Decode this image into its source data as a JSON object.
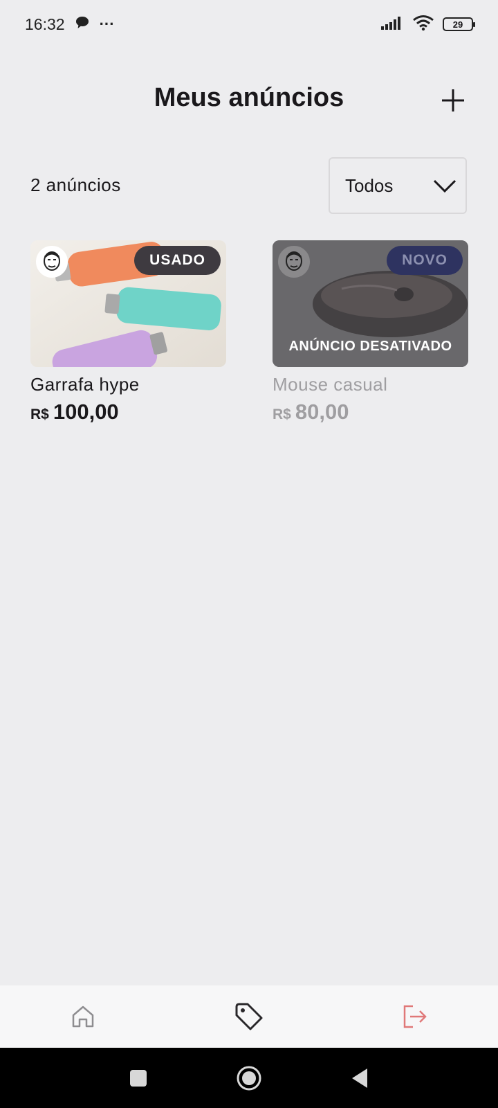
{
  "status_bar": {
    "time": "16:32",
    "dots": "···",
    "battery": "29",
    "icons": [
      "chat-bubble-icon",
      "more-dots-icon",
      "signal-icon",
      "wifi-icon",
      "battery-icon"
    ]
  },
  "header": {
    "title": "Meus anúncios",
    "add_icon": "plus-icon"
  },
  "filter": {
    "count_label": "2 anúncios",
    "selected": "Todos",
    "dropdown_icon": "chevron-down-icon"
  },
  "ads": [
    {
      "name": "Garrafa hype",
      "currency": "R$",
      "price": "100,00",
      "condition": "USADO",
      "disabled": false
    },
    {
      "name": "Mouse casual",
      "currency": "R$",
      "price": "80,00",
      "condition": "NOVO",
      "disabled": true,
      "disabled_label": "ANÚNCIO DESATIVADO"
    }
  ],
  "bottom_nav": {
    "items": [
      {
        "name": "home",
        "icon": "home-icon",
        "active": false
      },
      {
        "name": "my-ads",
        "icon": "tag-icon",
        "active": true
      },
      {
        "name": "logout",
        "icon": "sign-out-icon",
        "active": false
      }
    ]
  },
  "colors": {
    "background": "#EDEDEF",
    "text": "#1A181B",
    "muted": "#9F9EA1",
    "badge_used": "#3E3A40",
    "badge_new": "#2E3360",
    "logout": "#E07878"
  }
}
